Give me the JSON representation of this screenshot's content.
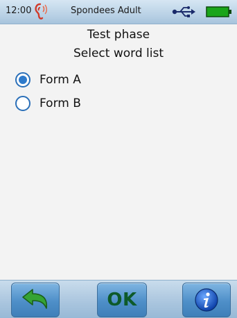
{
  "status_bar": {
    "time": "12:00",
    "app_title": "Spondees Adult",
    "icons": [
      "ear-icon",
      "usb-icon",
      "battery-icon"
    ],
    "battery_color": "#1aa51a"
  },
  "content": {
    "heading_line1": "Test phase",
    "heading_line2": "Select word list",
    "options": [
      {
        "label": "Form A",
        "selected": true
      },
      {
        "label": "Form B",
        "selected": false
      }
    ]
  },
  "toolbar": {
    "back_icon": "back-arrow-icon",
    "ok_label": "OK",
    "info_icon": "info-icon"
  },
  "colors": {
    "accent": "#2e7acb",
    "toolbar_button": "#4e8fc8",
    "ok_text": "#0d5a2a",
    "back_arrow": "#2f9a2f"
  }
}
